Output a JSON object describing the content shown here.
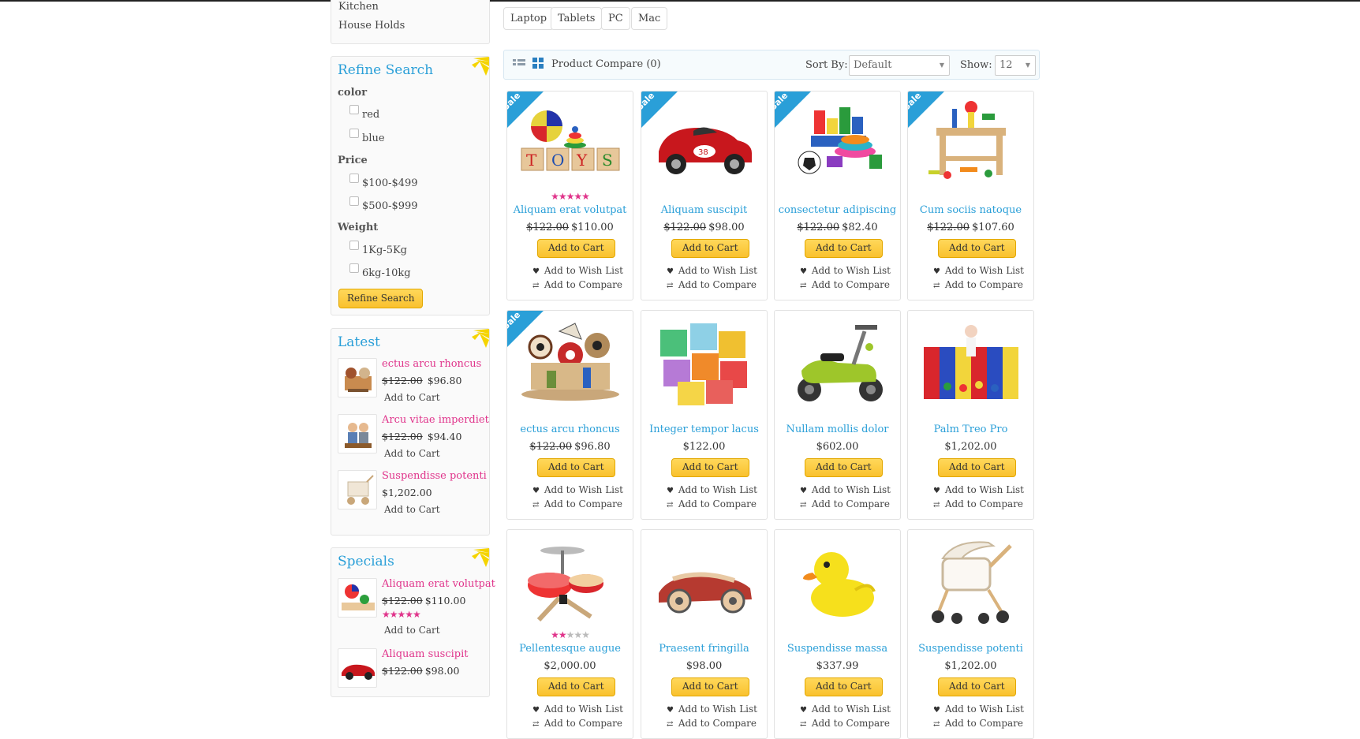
{
  "categories": [
    "Kitchen",
    "House Holds"
  ],
  "filters": [
    "Laptop",
    "Tablets",
    "PC",
    "Mac"
  ],
  "refine": {
    "title": "Refine Search",
    "groups": [
      {
        "name": "color",
        "options": [
          "red",
          "blue"
        ]
      },
      {
        "name": "Price",
        "options": [
          "$100-$499",
          "$500-$999"
        ]
      },
      {
        "name": "Weight",
        "options": [
          "1Kg-5Kg",
          "6kg-10kg"
        ]
      }
    ],
    "button": "Refine Search"
  },
  "latest": {
    "title": "Latest",
    "items": [
      {
        "name": "ectus arcu rhoncus",
        "old": "$122.00",
        "price": "$96.80",
        "cart": "Add to Cart"
      },
      {
        "name": "Arcu vitae imperdiet",
        "old": "$122.00",
        "price": "$94.40",
        "cart": "Add to Cart"
      },
      {
        "name": "Suspendisse potenti",
        "old": "",
        "price": "$1,202.00",
        "cart": "Add to Cart"
      }
    ]
  },
  "specials": {
    "title": "Specials",
    "items": [
      {
        "name": "Aliquam erat volutpat",
        "old": "$122.00",
        "price": "$110.00",
        "stars": "5/5",
        "cart": "Add to Cart"
      },
      {
        "name": "Aliquam suscipit",
        "old": "$122.00",
        "price": "$98.00"
      }
    ]
  },
  "toolbar": {
    "compare": "Product Compare (0)",
    "sort_label": "Sort By:",
    "sort_value": "Default",
    "show_label": "Show:",
    "show_value": "12"
  },
  "card_labels": {
    "sale": "Sale",
    "cart": "Add to Cart",
    "wish": "Add to Wish List",
    "compare": "Add to Compare"
  },
  "products": [
    {
      "name": "Aliquam erat volutpat",
      "old": "$122.00",
      "price": "$110.00",
      "sale": true,
      "stars": "5/5"
    },
    {
      "name": "Aliquam suscipit",
      "old": "$122.00",
      "price": "$98.00",
      "sale": true
    },
    {
      "name": "consectetur adipiscing",
      "old": "$122.00",
      "price": "$82.40",
      "sale": true
    },
    {
      "name": "Cum sociis natoque",
      "old": "$122.00",
      "price": "$107.60",
      "sale": true
    },
    {
      "name": "ectus arcu rhoncus",
      "old": "$122.00",
      "price": "$96.80",
      "sale": true
    },
    {
      "name": "Integer tempor lacus",
      "old": "",
      "price": "$122.00",
      "sale": false
    },
    {
      "name": "Nullam mollis dolor",
      "old": "",
      "price": "$602.00",
      "sale": false
    },
    {
      "name": "Palm Treo Pro",
      "old": "",
      "price": "$1,202.00",
      "sale": false
    },
    {
      "name": "Pellentesque augue",
      "old": "",
      "price": "$2,000.00",
      "sale": false,
      "stars": "2/5"
    },
    {
      "name": "Praesent fringilla",
      "old": "",
      "price": "$98.00",
      "sale": false
    },
    {
      "name": "Suspendisse massa",
      "old": "",
      "price": "$337.99",
      "sale": false
    },
    {
      "name": "Suspendisse potenti",
      "old": "",
      "price": "$1,202.00",
      "sale": false
    }
  ],
  "colors": {
    "accent": "#2a9fd8",
    "pink": "#e0348b",
    "button": "#f9c12e"
  }
}
